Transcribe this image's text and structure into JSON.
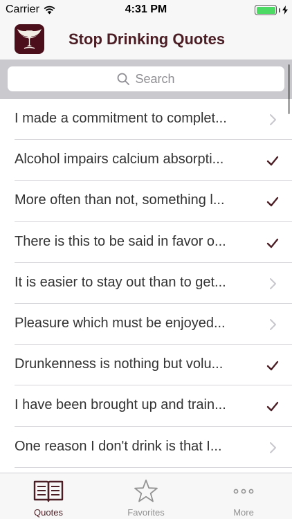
{
  "status_bar": {
    "carrier": "Carrier",
    "time": "4:31 PM",
    "wifi_icon": "wifi-icon",
    "battery_icon": "battery-icon",
    "battery_color": "#4cd964"
  },
  "nav": {
    "title": "Stop Drinking Quotes",
    "logo_icon": "winged-goblet-logo",
    "title_color": "#4a1e24"
  },
  "search": {
    "placeholder": "Search",
    "icon": "search-icon"
  },
  "list": {
    "rows": [
      {
        "text": "I made a commitment to complet...",
        "accessory": "chevron"
      },
      {
        "text": "Alcohol impairs calcium absorpti...",
        "accessory": "checkmark"
      },
      {
        "text": "More often than not, something l...",
        "accessory": "checkmark"
      },
      {
        "text": "There is this to be said in favor o...",
        "accessory": "checkmark"
      },
      {
        "text": "It is easier to stay out than to get...",
        "accessory": "chevron"
      },
      {
        "text": "Pleasure which must be enjoyed...",
        "accessory": "chevron"
      },
      {
        "text": "Drunkenness is nothing but volu...",
        "accessory": "checkmark"
      },
      {
        "text": "I have been brought up and train...",
        "accessory": "checkmark"
      },
      {
        "text": "One reason I don't drink is that I...",
        "accessory": "chevron"
      }
    ]
  },
  "tab_bar": {
    "tabs": [
      {
        "label": "Quotes",
        "icon": "book-icon",
        "selected": true
      },
      {
        "label": "Favorites",
        "icon": "star-icon",
        "selected": false
      },
      {
        "label": "More",
        "icon": "more-icon",
        "selected": false
      }
    ]
  },
  "colors": {
    "accent": "#4a1e24",
    "checkmark": "#4a1e24",
    "chevron": "#c7c7cc",
    "tab_inactive": "#929292",
    "search_bar_background": "#c9c9ce"
  }
}
